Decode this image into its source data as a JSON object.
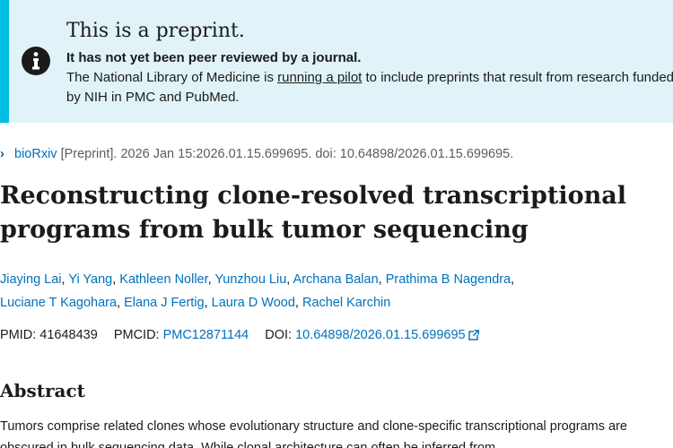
{
  "banner": {
    "title": "This is a preprint.",
    "strong": "It has not yet been peer reviewed by a journal.",
    "body_before": "The National Library of Medicine is ",
    "body_link": "running a pilot",
    "body_after": " to include preprints that result from research funded by NIH in PMC and PubMed.",
    "icon": "info-icon",
    "accent": "#00bde3",
    "background": "#e1f3f8"
  },
  "citation": {
    "source": "bioRxiv",
    "rest": " [Preprint]. 2026 Jan 15:2026.01.15.699695. doi: 10.64898/2026.01.15.699695."
  },
  "title": "Reconstructing clone-resolved transcriptional programs from bulk tumor sequencing",
  "authors": [
    "Jiaying Lai",
    "Yi Yang",
    "Kathleen Noller",
    "Yunzhou Liu",
    "Archana Balan",
    "Prathima B Nagendra",
    "Luciane T Kagohara",
    "Elana J Fertig",
    "Laura D Wood",
    "Rachel Karchin"
  ],
  "ids": {
    "pmid_label": "PMID:",
    "pmid": "41648439",
    "pmcid_label": "PMCID:",
    "pmcid": "PMC12871144",
    "doi_label": "DOI:",
    "doi": "10.64898/2026.01.15.699695"
  },
  "abstract": {
    "heading": "Abstract",
    "text": "Tumors comprise related clones whose evolutionary structure and clone-specific transcriptional programs are obscured in bulk sequencing data. While clonal architecture can often be inferred from"
  },
  "colors": {
    "link": "#0071bc",
    "text": "#1b1b1b"
  }
}
